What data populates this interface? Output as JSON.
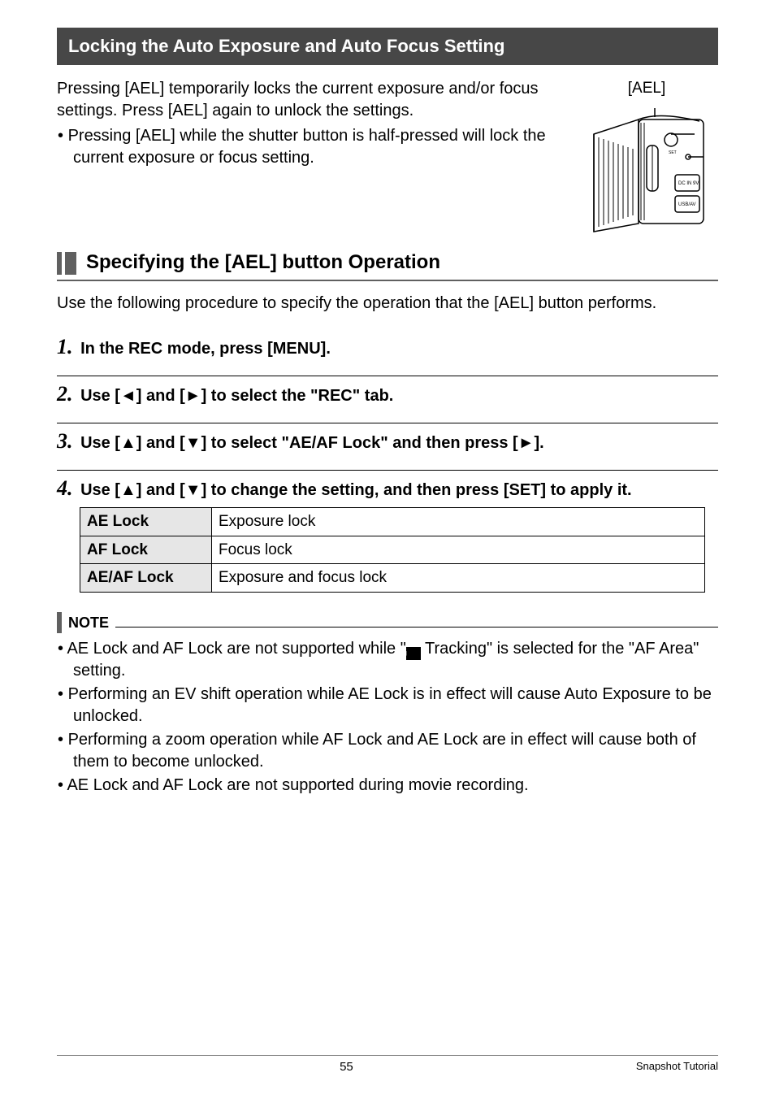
{
  "heading": "Locking the Auto Exposure and Auto Focus Setting",
  "intro": {
    "para": "Pressing [AEL] temporarily locks the current exposure and/or focus settings. Press [AEL] again to unlock the settings.",
    "bullet": "Pressing [AEL] while the shutter button is half-pressed will lock the current exposure or focus setting."
  },
  "diagram_label": "[AEL]",
  "subheading": "Specifying the [AEL] button Operation",
  "subpara": "Use the following procedure to specify the operation that the [AEL] button performs.",
  "steps": {
    "s1": "In the REC mode, press [MENU].",
    "s2_a": "Use [",
    "s2_b": "] and [",
    "s2_c": "] to select the \"REC\" tab.",
    "s3_a": "Use [",
    "s3_b": "] and [",
    "s3_c": "] to select \"AE/AF Lock\" and then press [",
    "s3_d": "].",
    "s4_a": "Use [",
    "s4_b": "] and [",
    "s4_c": "] to change the setting, and then press [SET] to apply it."
  },
  "arrows": {
    "left": "◄",
    "right": "►",
    "up": "▲",
    "down": "▼"
  },
  "table": {
    "r1_name": "AE Lock",
    "r1_desc": "Exposure lock",
    "r2_name": "AF Lock",
    "r2_desc": "Focus lock",
    "r3_name": "AE/AF Lock",
    "r3_desc": "Exposure and focus lock"
  },
  "note_label": "NOTE",
  "notes": {
    "n1_a": "AE Lock and AF Lock are not supported while \"",
    "n1_b": " Tracking\" is selected for the \"AF Area\" setting.",
    "n2": "Performing an EV shift operation while AE Lock is in effect will cause Auto Exposure to be unlocked.",
    "n3": "Performing a zoom operation while AF Lock and AE Lock are in effect will cause both of them to become unlocked.",
    "n4": "AE Lock and AF Lock are not supported during movie recording."
  },
  "footer": {
    "page": "55",
    "section": "Snapshot Tutorial"
  }
}
